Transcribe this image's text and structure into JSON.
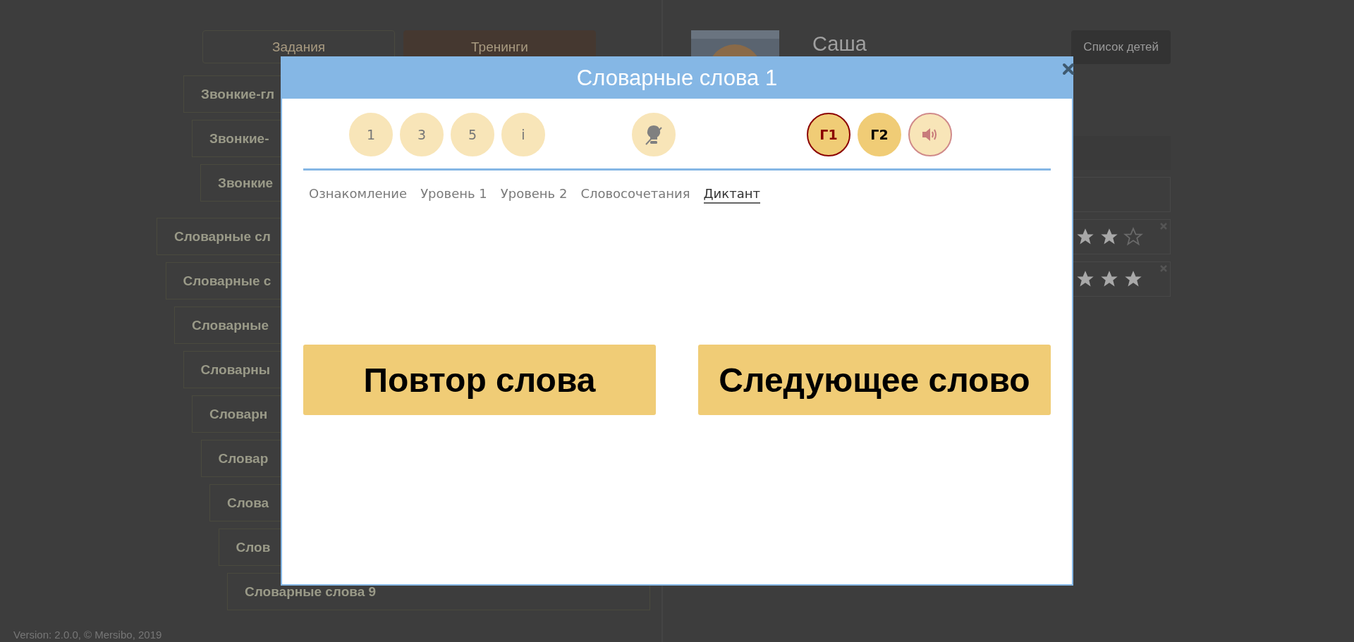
{
  "background": {
    "tabs": [
      {
        "label": "Задания",
        "selected": false
      },
      {
        "label": "Тренинги",
        "selected": true
      }
    ],
    "topics": [
      "Звонкие-гл",
      "Звонкие-",
      "Звонкие"
    ],
    "words": [
      "Словарные сл",
      "Словарные с",
      "Словарные",
      "Словарны",
      "Словарн",
      "Словар",
      "Слова",
      "Слов",
      "Словарные слова 9"
    ],
    "child_name": "Саша",
    "list_button": "Список детей",
    "results": [
      {
        "stars": 2
      },
      {
        "stars": 3
      }
    ],
    "version": "Version: 2.0.0, © Mersibo, 2019"
  },
  "modal": {
    "title": "Словарные слова 1",
    "modes": [
      {
        "label": "1"
      },
      {
        "label": "3"
      },
      {
        "label": "5"
      },
      {
        "label": "i"
      }
    ],
    "voices": [
      {
        "label": "Г1",
        "selected": true
      },
      {
        "label": "Г2",
        "selected": false
      }
    ],
    "tabs": [
      {
        "label": "Ознакомление",
        "selected": false
      },
      {
        "label": "Уровень 1",
        "selected": false
      },
      {
        "label": "Уровень 2",
        "selected": false
      },
      {
        "label": "Словосочетания",
        "selected": false
      },
      {
        "label": "Диктант",
        "selected": true
      }
    ],
    "actions": [
      "Повтор слова",
      "Следующее слово"
    ]
  }
}
